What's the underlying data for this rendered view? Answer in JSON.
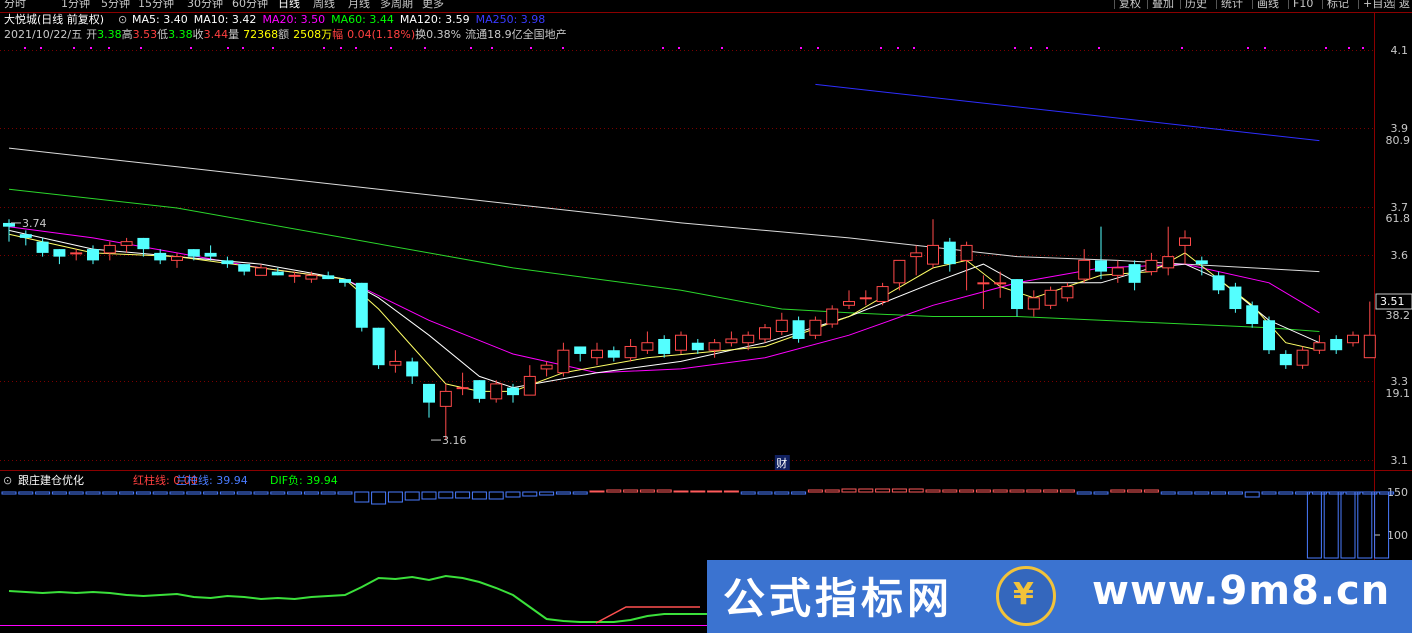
{
  "toolbar": {
    "periods": [
      "分时",
      "1分钟",
      "5分钟",
      "15分钟",
      "30分钟",
      "60分钟",
      "日线",
      "周线",
      "月线",
      "多周期",
      "更多"
    ],
    "active_period": "日线",
    "tools": [
      "复权",
      "叠加",
      "历史",
      "统计",
      "画线",
      "F10",
      "标记",
      "+自选",
      "返"
    ]
  },
  "stock": {
    "name": "大悦城(日线 前复权)",
    "ma": [
      {
        "label": "MA5: 3.40",
        "color": "#ffffff"
      },
      {
        "label": "MA10: 3.42",
        "color": "#ffffff"
      },
      {
        "label": "MA20: 3.50",
        "color": "#ff00ff"
      },
      {
        "label": "MA60: 3.44",
        "color": "#00ff00"
      },
      {
        "label": "MA120: 3.59",
        "color": "#ffffff"
      },
      {
        "label": "MA250: 3.98",
        "color": "#3a3aff"
      }
    ],
    "info": [
      {
        "text": "2021/10/22/五",
        "color": "#c8c8c8"
      },
      {
        "text": "开",
        "color": "#c8c8c8"
      },
      {
        "text": "3.38",
        "color": "#00ff00"
      },
      {
        "text": "高",
        "color": "#c8c8c8"
      },
      {
        "text": "3.53",
        "color": "#ff4040"
      },
      {
        "text": "低",
        "color": "#c8c8c8"
      },
      {
        "text": "3.38",
        "color": "#00ff00"
      },
      {
        "text": "收",
        "color": "#c8c8c8"
      },
      {
        "text": "3.44",
        "color": "#ff4040"
      },
      {
        "text": "量",
        "color": "#c8c8c8"
      },
      {
        "text": "72368",
        "color": "#ffff00"
      },
      {
        "text": "额",
        "color": "#c8c8c8"
      },
      {
        "text": "2508万",
        "color": "#ffff00"
      },
      {
        "text": "幅",
        "color": "#ff4040"
      },
      {
        "text": "0.04(1.18%)",
        "color": "#ff4040"
      },
      {
        "text": "换0.38%",
        "color": "#c8c8c8"
      },
      {
        "text": "流通18.9亿",
        "color": "#c8c8c8"
      },
      {
        "text": "全国地产",
        "color": "#c8c8c8"
      }
    ]
  },
  "chart_data": [
    {
      "type": "candlestick",
      "title": "大悦城(日线 前复权)",
      "ylim": [
        3.08,
        4.21
      ],
      "price_ticks": [
        "4.1",
        "3.9",
        "3.7",
        "3.6",
        "3.3",
        "3.1"
      ],
      "pct_ticks": [
        "80.9",
        "61.8",
        "38.2",
        "19.1"
      ],
      "current_price": "3.51",
      "annotations": [
        {
          "text": "3.74",
          "index": 0,
          "value": 3.74
        },
        {
          "text": "3.16",
          "index": 25,
          "value": 3.16
        }
      ],
      "event_markers": [
        {
          "text": "财",
          "index": 46
        }
      ],
      "candles": [
        [
          3.74,
          3.73,
          3.75,
          3.69
        ],
        [
          3.71,
          3.7,
          3.72,
          3.68
        ],
        [
          3.69,
          3.66,
          3.7,
          3.65
        ],
        [
          3.67,
          3.65,
          3.67,
          3.63
        ],
        [
          3.66,
          3.66,
          3.67,
          3.64
        ],
        [
          3.67,
          3.64,
          3.68,
          3.63
        ],
        [
          3.66,
          3.68,
          3.69,
          3.64
        ],
        [
          3.68,
          3.69,
          3.7,
          3.66
        ],
        [
          3.7,
          3.67,
          3.7,
          3.65
        ],
        [
          3.66,
          3.64,
          3.67,
          3.63
        ],
        [
          3.64,
          3.65,
          3.66,
          3.62
        ],
        [
          3.67,
          3.65,
          3.67,
          3.64
        ],
        [
          3.66,
          3.65,
          3.68,
          3.64
        ],
        [
          3.64,
          3.63,
          3.65,
          3.62
        ],
        [
          3.63,
          3.61,
          3.63,
          3.6
        ],
        [
          3.6,
          3.62,
          3.63,
          3.6
        ],
        [
          3.61,
          3.6,
          3.62,
          3.6
        ],
        [
          3.6,
          3.6,
          3.61,
          3.58
        ],
        [
          3.59,
          3.6,
          3.61,
          3.58
        ],
        [
          3.6,
          3.59,
          3.61,
          3.59
        ],
        [
          3.59,
          3.58,
          3.59,
          3.57
        ],
        [
          3.58,
          3.46,
          3.58,
          3.45
        ],
        [
          3.46,
          3.36,
          3.46,
          3.35
        ],
        [
          3.36,
          3.37,
          3.4,
          3.34
        ],
        [
          3.37,
          3.33,
          3.38,
          3.31
        ],
        [
          3.31,
          3.26,
          3.31,
          3.22
        ],
        [
          3.25,
          3.29,
          3.31,
          3.16
        ],
        [
          3.3,
          3.3,
          3.34,
          3.28
        ],
        [
          3.32,
          3.27,
          3.32,
          3.26
        ],
        [
          3.27,
          3.31,
          3.32,
          3.26
        ],
        [
          3.3,
          3.28,
          3.31,
          3.26
        ],
        [
          3.28,
          3.33,
          3.36,
          3.28
        ],
        [
          3.35,
          3.36,
          3.37,
          3.33
        ],
        [
          3.34,
          3.4,
          3.42,
          3.33
        ],
        [
          3.41,
          3.39,
          3.41,
          3.37
        ],
        [
          3.38,
          3.4,
          3.42,
          3.36
        ],
        [
          3.4,
          3.38,
          3.41,
          3.37
        ],
        [
          3.38,
          3.41,
          3.43,
          3.37
        ],
        [
          3.4,
          3.42,
          3.45,
          3.39
        ],
        [
          3.43,
          3.39,
          3.44,
          3.38
        ],
        [
          3.4,
          3.44,
          3.45,
          3.39
        ],
        [
          3.42,
          3.4,
          3.43,
          3.39
        ],
        [
          3.4,
          3.42,
          3.43,
          3.38
        ],
        [
          3.42,
          3.43,
          3.45,
          3.41
        ],
        [
          3.42,
          3.44,
          3.45,
          3.4
        ],
        [
          3.43,
          3.46,
          3.47,
          3.42
        ],
        [
          3.45,
          3.48,
          3.5,
          3.44
        ],
        [
          3.48,
          3.43,
          3.49,
          3.42
        ],
        [
          3.44,
          3.48,
          3.49,
          3.43
        ],
        [
          3.47,
          3.51,
          3.52,
          3.46
        ],
        [
          3.52,
          3.53,
          3.56,
          3.51
        ],
        [
          3.54,
          3.54,
          3.56,
          3.52
        ],
        [
          3.53,
          3.57,
          3.58,
          3.52
        ],
        [
          3.58,
          3.64,
          3.64,
          3.56
        ],
        [
          3.65,
          3.66,
          3.68,
          3.6
        ],
        [
          3.63,
          3.68,
          3.75,
          3.62
        ],
        [
          3.69,
          3.63,
          3.7,
          3.61
        ],
        [
          3.64,
          3.68,
          3.69,
          3.56
        ],
        [
          3.58,
          3.58,
          3.6,
          3.51
        ],
        [
          3.58,
          3.58,
          3.61,
          3.54
        ],
        [
          3.59,
          3.51,
          3.59,
          3.49
        ],
        [
          3.51,
          3.54,
          3.56,
          3.49
        ],
        [
          3.52,
          3.56,
          3.57,
          3.51
        ],
        [
          3.54,
          3.57,
          3.58,
          3.53
        ],
        [
          3.59,
          3.64,
          3.67,
          3.58
        ],
        [
          3.64,
          3.61,
          3.73,
          3.59
        ],
        [
          3.6,
          3.62,
          3.64,
          3.58
        ],
        [
          3.63,
          3.58,
          3.64,
          3.56
        ],
        [
          3.61,
          3.64,
          3.66,
          3.6
        ],
        [
          3.62,
          3.65,
          3.73,
          3.6
        ],
        [
          3.68,
          3.7,
          3.72,
          3.63
        ],
        [
          3.64,
          3.63,
          3.65,
          3.6
        ],
        [
          3.6,
          3.56,
          3.61,
          3.55
        ],
        [
          3.57,
          3.51,
          3.58,
          3.5
        ],
        [
          3.52,
          3.47,
          3.53,
          3.46
        ],
        [
          3.48,
          3.4,
          3.49,
          3.39
        ],
        [
          3.39,
          3.36,
          3.4,
          3.35
        ],
        [
          3.36,
          3.4,
          3.41,
          3.35
        ],
        [
          3.4,
          3.42,
          3.44,
          3.39
        ],
        [
          3.43,
          3.4,
          3.44,
          3.39
        ],
        [
          3.42,
          3.44,
          3.45,
          3.41
        ],
        [
          3.38,
          3.44,
          3.53,
          3.38
        ]
      ],
      "series": [
        {
          "name": "MA250",
          "color": "#2e2eff",
          "values": [
            [
              48,
              4.11
            ],
            [
              78,
              3.96
            ]
          ]
        },
        {
          "name": "MA120",
          "color": "#dcdcdc",
          "values": [
            [
              0,
              3.94
            ],
            [
              10,
              3.89
            ],
            [
              20,
              3.84
            ],
            [
              30,
              3.79
            ],
            [
              40,
              3.74
            ],
            [
              50,
              3.7
            ],
            [
              56,
              3.67
            ],
            [
              60,
              3.65
            ],
            [
              66,
              3.64
            ],
            [
              70,
              3.63
            ],
            [
              78,
              3.61
            ]
          ]
        },
        {
          "name": "MA60",
          "color": "#2bd62b",
          "values": [
            [
              0,
              3.83
            ],
            [
              10,
              3.78
            ],
            [
              20,
              3.7
            ],
            [
              30,
              3.62
            ],
            [
              40,
              3.56
            ],
            [
              46,
              3.51
            ],
            [
              50,
              3.5
            ],
            [
              55,
              3.49
            ],
            [
              60,
              3.49
            ],
            [
              65,
              3.48
            ],
            [
              70,
              3.47
            ],
            [
              75,
              3.46
            ],
            [
              78,
              3.45
            ]
          ]
        },
        {
          "name": "MA20",
          "color": "#ff00ff",
          "values": [
            [
              0,
              3.73
            ],
            [
              5,
              3.7
            ],
            [
              10,
              3.66
            ],
            [
              15,
              3.62
            ],
            [
              20,
              3.59
            ],
            [
              25,
              3.48
            ],
            [
              30,
              3.39
            ],
            [
              35,
              3.34
            ],
            [
              40,
              3.35
            ],
            [
              45,
              3.38
            ],
            [
              50,
              3.44
            ],
            [
              55,
              3.52
            ],
            [
              60,
              3.58
            ],
            [
              65,
              3.62
            ],
            [
              70,
              3.63
            ],
            [
              75,
              3.58
            ],
            [
              78,
              3.5
            ]
          ]
        },
        {
          "name": "MA10",
          "color": "#ffffff",
          "values": [
            [
              0,
              3.72
            ],
            [
              5,
              3.67
            ],
            [
              10,
              3.65
            ],
            [
              15,
              3.63
            ],
            [
              20,
              3.59
            ],
            [
              22,
              3.54
            ],
            [
              25,
              3.44
            ],
            [
              28,
              3.33
            ],
            [
              30,
              3.3
            ],
            [
              35,
              3.34
            ],
            [
              40,
              3.37
            ],
            [
              45,
              3.42
            ],
            [
              50,
              3.49
            ],
            [
              55,
              3.58
            ],
            [
              58,
              3.63
            ],
            [
              60,
              3.58
            ],
            [
              65,
              3.58
            ],
            [
              68,
              3.62
            ],
            [
              70,
              3.63
            ],
            [
              72,
              3.59
            ],
            [
              75,
              3.48
            ],
            [
              78,
              3.42
            ]
          ]
        },
        {
          "name": "MA5",
          "color": "#ffff66",
          "values": [
            [
              0,
              3.71
            ],
            [
              5,
              3.66
            ],
            [
              10,
              3.65
            ],
            [
              15,
              3.62
            ],
            [
              20,
              3.59
            ],
            [
              22,
              3.51
            ],
            [
              24,
              3.41
            ],
            [
              26,
              3.31
            ],
            [
              28,
              3.29
            ],
            [
              30,
              3.29
            ],
            [
              33,
              3.34
            ],
            [
              38,
              3.38
            ],
            [
              45,
              3.41
            ],
            [
              50,
              3.49
            ],
            [
              55,
              3.62
            ],
            [
              57,
              3.64
            ],
            [
              59,
              3.57
            ],
            [
              61,
              3.54
            ],
            [
              65,
              3.6
            ],
            [
              68,
              3.61
            ],
            [
              70,
              3.66
            ],
            [
              72,
              3.59
            ],
            [
              74,
              3.52
            ],
            [
              76,
              3.42
            ],
            [
              78,
              3.4
            ]
          ]
        }
      ]
    },
    {
      "type": "bar",
      "title": "跟庄建仓优化",
      "legend": [
        {
          "text": "红柱线: 0.00",
          "color": "#ff4040"
        },
        {
          "text": "兰柱线: 39.94",
          "color": "#4a7cff"
        },
        {
          "text": "DIF负: 39.94",
          "color": "#00ff00"
        }
      ],
      "ylim": [
        0,
        190
      ],
      "y_ticks": [
        "150",
        "100"
      ],
      "bars": [
        2,
        2,
        2,
        2,
        2,
        2,
        2,
        2,
        2,
        2,
        2,
        2,
        2,
        2,
        2,
        2,
        2,
        2,
        2,
        2,
        2,
        10,
        12,
        10,
        8,
        7,
        6,
        6,
        7,
        7,
        5,
        4,
        3,
        2,
        2,
        -1,
        -2,
        -2,
        -2,
        -2,
        -1,
        -1,
        -1,
        -1,
        2,
        2,
        2,
        2,
        -2,
        -2,
        -3,
        -3,
        -3,
        -3,
        -3,
        -2,
        -2,
        -2,
        -2,
        -2,
        -2,
        -2,
        -2,
        -2,
        2,
        2,
        -2,
        -2,
        -2,
        2,
        2,
        2,
        2,
        2,
        5,
        2,
        2,
        2,
        2,
        2,
        2,
        2,
        2
      ],
      "tall_bars": [
        {
          "index": 78,
          "value": 150
        },
        {
          "index": 79,
          "value": 150
        },
        {
          "index": 80,
          "value": 150
        },
        {
          "index": 81,
          "value": 150
        },
        {
          "index": 82,
          "value": 150
        }
      ],
      "dif": [
        32,
        31,
        30,
        31,
        30,
        31,
        30,
        28,
        27,
        28,
        29,
        26,
        25,
        27,
        26,
        24,
        25,
        24,
        26,
        27,
        28,
        36,
        45,
        44,
        46,
        43,
        47,
        45,
        41,
        35,
        28,
        16,
        4,
        2,
        1,
        1,
        1,
        3,
        7,
        9,
        9,
        9,
        9
      ]
    }
  ],
  "watermark": {
    "text": "公式指标网",
    "url": "www.9m8.cn"
  }
}
